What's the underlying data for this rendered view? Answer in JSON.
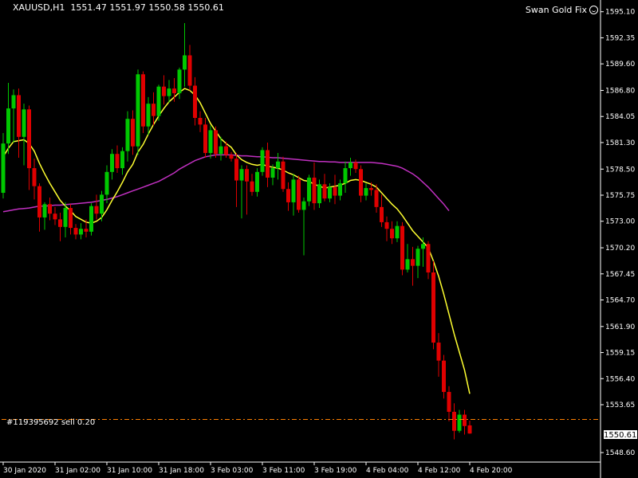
{
  "header": {
    "symbol": "XAUUSD,H1",
    "ohlc": "1551.47 1551.97 1550.58 1550.61"
  },
  "expert": {
    "name": "Swan Gold Fix",
    "icon": "smiley-icon"
  },
  "order": {
    "label": "#119395692 sell 0.20",
    "price": 1552.1
  },
  "current_price": "1550.61",
  "colors": {
    "background": "#000000",
    "bull": "#00c800",
    "bear": "#e00000",
    "ma_fast": "#ffff30",
    "ma_slow": "#c030c0",
    "order_line": "#ff8000",
    "axis": "#ffffff"
  },
  "chart_data": {
    "type": "candlestick",
    "y_ticks": [
      "1595.10",
      "1592.35",
      "1589.60",
      "1586.80",
      "1584.05",
      "1581.30",
      "1578.50",
      "1575.75",
      "1573.00",
      "1570.20",
      "1567.45",
      "1564.70",
      "1561.90",
      "1559.15",
      "1556.40",
      "1553.65",
      "1548.60"
    ],
    "ylim": [
      1547.6,
      1596.0
    ],
    "x_ticks": [
      "30 Jan 2020",
      "31 Jan 02:00",
      "31 Jan 10:00",
      "31 Jan 18:00",
      "3 Feb 03:00",
      "3 Feb 11:00",
      "3 Feb 19:00",
      "4 Feb 04:00",
      "4 Feb 12:00",
      "4 Feb 20:00"
    ],
    "x_tick_index": [
      0,
      10,
      20,
      30,
      40,
      50,
      60,
      70,
      80,
      90
    ],
    "candles": [
      {
        "o": 1576.0,
        "h": 1582.3,
        "l": 1575.4,
        "c": 1581.2
      },
      {
        "o": 1581.2,
        "h": 1587.6,
        "l": 1580.1,
        "c": 1584.9
      },
      {
        "o": 1584.9,
        "h": 1586.9,
        "l": 1581.3,
        "c": 1586.3
      },
      {
        "o": 1586.3,
        "h": 1587.0,
        "l": 1579.7,
        "c": 1581.9
      },
      {
        "o": 1581.9,
        "h": 1585.4,
        "l": 1578.9,
        "c": 1584.8
      },
      {
        "o": 1584.8,
        "h": 1585.2,
        "l": 1576.3,
        "c": 1578.6
      },
      {
        "o": 1578.6,
        "h": 1579.6,
        "l": 1575.3,
        "c": 1576.7
      },
      {
        "o": 1576.7,
        "h": 1577.0,
        "l": 1571.9,
        "c": 1573.4
      },
      {
        "o": 1573.4,
        "h": 1575.0,
        "l": 1572.1,
        "c": 1574.8
      },
      {
        "o": 1574.8,
        "h": 1575.5,
        "l": 1573.1,
        "c": 1573.8
      },
      {
        "o": 1573.8,
        "h": 1574.5,
        "l": 1572.6,
        "c": 1573.2
      },
      {
        "o": 1573.2,
        "h": 1573.9,
        "l": 1570.9,
        "c": 1572.4
      },
      {
        "o": 1572.4,
        "h": 1575.0,
        "l": 1571.3,
        "c": 1574.4
      },
      {
        "o": 1574.4,
        "h": 1574.8,
        "l": 1571.6,
        "c": 1572.3
      },
      {
        "o": 1572.3,
        "h": 1572.7,
        "l": 1571.1,
        "c": 1571.6
      },
      {
        "o": 1571.6,
        "h": 1572.8,
        "l": 1571.1,
        "c": 1572.2
      },
      {
        "o": 1572.2,
        "h": 1573.2,
        "l": 1571.3,
        "c": 1571.9
      },
      {
        "o": 1571.9,
        "h": 1574.9,
        "l": 1571.5,
        "c": 1574.6
      },
      {
        "o": 1574.6,
        "h": 1575.8,
        "l": 1573.2,
        "c": 1573.8
      },
      {
        "o": 1573.8,
        "h": 1576.2,
        "l": 1573.0,
        "c": 1575.8
      },
      {
        "o": 1575.8,
        "h": 1578.9,
        "l": 1574.9,
        "c": 1578.2
      },
      {
        "o": 1578.2,
        "h": 1580.6,
        "l": 1577.4,
        "c": 1580.1
      },
      {
        "o": 1580.1,
        "h": 1581.0,
        "l": 1578.1,
        "c": 1578.6
      },
      {
        "o": 1578.6,
        "h": 1580.8,
        "l": 1577.9,
        "c": 1580.4
      },
      {
        "o": 1580.4,
        "h": 1584.6,
        "l": 1579.3,
        "c": 1583.8
      },
      {
        "o": 1583.8,
        "h": 1584.7,
        "l": 1580.0,
        "c": 1580.9
      },
      {
        "o": 1580.9,
        "h": 1589.0,
        "l": 1580.0,
        "c": 1588.5
      },
      {
        "o": 1588.5,
        "h": 1588.8,
        "l": 1582.3,
        "c": 1583.0
      },
      {
        "o": 1583.0,
        "h": 1586.1,
        "l": 1582.1,
        "c": 1585.4
      },
      {
        "o": 1585.4,
        "h": 1586.6,
        "l": 1583.1,
        "c": 1584.1
      },
      {
        "o": 1584.1,
        "h": 1587.4,
        "l": 1583.6,
        "c": 1587.2
      },
      {
        "o": 1587.2,
        "h": 1588.4,
        "l": 1585.3,
        "c": 1586.2
      },
      {
        "o": 1586.2,
        "h": 1587.9,
        "l": 1585.5,
        "c": 1587.0
      },
      {
        "o": 1587.0,
        "h": 1588.1,
        "l": 1585.6,
        "c": 1586.5
      },
      {
        "o": 1586.5,
        "h": 1589.2,
        "l": 1585.9,
        "c": 1589.0
      },
      {
        "o": 1589.0,
        "h": 1593.9,
        "l": 1587.2,
        "c": 1590.5
      },
      {
        "o": 1590.5,
        "h": 1591.6,
        "l": 1586.8,
        "c": 1587.3
      },
      {
        "o": 1587.3,
        "h": 1588.2,
        "l": 1583.1,
        "c": 1583.9
      },
      {
        "o": 1583.9,
        "h": 1584.6,
        "l": 1582.4,
        "c": 1583.2
      },
      {
        "o": 1583.2,
        "h": 1583.9,
        "l": 1579.7,
        "c": 1580.2
      },
      {
        "o": 1580.2,
        "h": 1583.1,
        "l": 1579.6,
        "c": 1582.6
      },
      {
        "o": 1582.6,
        "h": 1583.0,
        "l": 1579.7,
        "c": 1580.1
      },
      {
        "o": 1580.1,
        "h": 1581.9,
        "l": 1579.4,
        "c": 1580.9
      },
      {
        "o": 1580.9,
        "h": 1581.4,
        "l": 1579.7,
        "c": 1580.0
      },
      {
        "o": 1580.0,
        "h": 1580.3,
        "l": 1579.3,
        "c": 1579.6
      },
      {
        "o": 1579.6,
        "h": 1580.2,
        "l": 1574.5,
        "c": 1577.3
      },
      {
        "o": 1577.3,
        "h": 1578.9,
        "l": 1573.3,
        "c": 1578.5
      },
      {
        "o": 1578.5,
        "h": 1578.9,
        "l": 1573.7,
        "c": 1577.2
      },
      {
        "o": 1577.2,
        "h": 1578.0,
        "l": 1575.7,
        "c": 1576.1
      },
      {
        "o": 1576.1,
        "h": 1578.6,
        "l": 1575.6,
        "c": 1578.2
      },
      {
        "o": 1578.2,
        "h": 1580.8,
        "l": 1577.8,
        "c": 1580.5
      },
      {
        "o": 1580.5,
        "h": 1581.3,
        "l": 1576.6,
        "c": 1577.6
      },
      {
        "o": 1577.6,
        "h": 1579.0,
        "l": 1576.8,
        "c": 1578.6
      },
      {
        "o": 1578.6,
        "h": 1580.2,
        "l": 1577.4,
        "c": 1579.3
      },
      {
        "o": 1579.3,
        "h": 1579.8,
        "l": 1576.1,
        "c": 1576.4
      },
      {
        "o": 1576.4,
        "h": 1577.1,
        "l": 1574.1,
        "c": 1575.0
      },
      {
        "o": 1575.0,
        "h": 1578.0,
        "l": 1573.6,
        "c": 1577.4
      },
      {
        "o": 1577.4,
        "h": 1577.8,
        "l": 1573.9,
        "c": 1574.2
      },
      {
        "o": 1574.2,
        "h": 1575.5,
        "l": 1569.4,
        "c": 1575.1
      },
      {
        "o": 1575.1,
        "h": 1577.9,
        "l": 1574.6,
        "c": 1577.6
      },
      {
        "o": 1577.6,
        "h": 1579.2,
        "l": 1574.2,
        "c": 1574.9
      },
      {
        "o": 1574.9,
        "h": 1577.4,
        "l": 1574.4,
        "c": 1576.9
      },
      {
        "o": 1576.9,
        "h": 1578.0,
        "l": 1575.1,
        "c": 1575.4
      },
      {
        "o": 1575.4,
        "h": 1577.0,
        "l": 1575.0,
        "c": 1576.6
      },
      {
        "o": 1576.6,
        "h": 1577.9,
        "l": 1574.8,
        "c": 1575.7
      },
      {
        "o": 1575.7,
        "h": 1577.4,
        "l": 1575.2,
        "c": 1577.0
      },
      {
        "o": 1577.0,
        "h": 1579.3,
        "l": 1576.0,
        "c": 1578.6
      },
      {
        "o": 1578.6,
        "h": 1579.7,
        "l": 1577.8,
        "c": 1579.2
      },
      {
        "o": 1579.2,
        "h": 1579.5,
        "l": 1578.1,
        "c": 1578.5
      },
      {
        "o": 1578.5,
        "h": 1578.9,
        "l": 1575.0,
        "c": 1575.7
      },
      {
        "o": 1575.7,
        "h": 1577.0,
        "l": 1575.2,
        "c": 1576.5
      },
      {
        "o": 1576.5,
        "h": 1577.1,
        "l": 1575.7,
        "c": 1576.3
      },
      {
        "o": 1576.3,
        "h": 1576.9,
        "l": 1573.9,
        "c": 1574.5
      },
      {
        "o": 1574.5,
        "h": 1575.8,
        "l": 1572.4,
        "c": 1572.9
      },
      {
        "o": 1572.9,
        "h": 1573.5,
        "l": 1570.9,
        "c": 1572.2
      },
      {
        "o": 1572.2,
        "h": 1573.0,
        "l": 1570.6,
        "c": 1571.2
      },
      {
        "o": 1571.2,
        "h": 1573.0,
        "l": 1570.8,
        "c": 1572.5
      },
      {
        "o": 1572.5,
        "h": 1572.9,
        "l": 1567.3,
        "c": 1567.9
      },
      {
        "o": 1567.9,
        "h": 1570.6,
        "l": 1567.6,
        "c": 1569.0
      },
      {
        "o": 1569.0,
        "h": 1570.3,
        "l": 1566.2,
        "c": 1568.3
      },
      {
        "o": 1568.3,
        "h": 1570.4,
        "l": 1567.0,
        "c": 1570.1
      },
      {
        "o": 1570.1,
        "h": 1571.3,
        "l": 1568.2,
        "c": 1570.6
      },
      {
        "o": 1570.6,
        "h": 1570.9,
        "l": 1566.9,
        "c": 1567.6
      },
      {
        "o": 1567.6,
        "h": 1568.8,
        "l": 1559.5,
        "c": 1560.2
      },
      {
        "o": 1560.2,
        "h": 1561.2,
        "l": 1556.6,
        "c": 1558.3
      },
      {
        "o": 1558.3,
        "h": 1558.9,
        "l": 1554.3,
        "c": 1555.0
      },
      {
        "o": 1555.0,
        "h": 1555.6,
        "l": 1551.9,
        "c": 1552.9
      },
      {
        "o": 1552.9,
        "h": 1553.8,
        "l": 1550.0,
        "c": 1550.9
      },
      {
        "o": 1550.9,
        "h": 1553.1,
        "l": 1550.7,
        "c": 1552.6
      },
      {
        "o": 1552.6,
        "h": 1553.1,
        "l": 1550.5,
        "c": 1551.4
      },
      {
        "o": 1551.47,
        "h": 1551.97,
        "l": 1550.58,
        "c": 1550.61
      }
    ],
    "ma_fast": [
      1579.8,
      1580.7,
      1581.4,
      1581.5,
      1581.6,
      1581.2,
      1580.4,
      1579.1,
      1578.0,
      1577.0,
      1576.1,
      1575.2,
      1574.6,
      1574.1,
      1573.5,
      1573.2,
      1572.9,
      1572.8,
      1573.0,
      1573.4,
      1574.2,
      1575.2,
      1576.1,
      1577.1,
      1578.2,
      1579.0,
      1580.3,
      1581.1,
      1582.2,
      1583.2,
      1584.1,
      1584.9,
      1585.6,
      1586.1,
      1586.6,
      1587.0,
      1586.8,
      1586.3,
      1585.5,
      1584.4,
      1583.3,
      1582.5,
      1581.7,
      1581.2,
      1580.8,
      1580.0,
      1579.5,
      1579.2,
      1579.0,
      1578.9,
      1579.0,
      1578.8,
      1578.7,
      1578.6,
      1578.4,
      1578.1,
      1577.9,
      1577.6,
      1577.3,
      1577.2,
      1576.9,
      1576.7,
      1576.5,
      1576.6,
      1576.7,
      1576.8,
      1577.0,
      1577.3,
      1577.4,
      1577.3,
      1577.1,
      1576.9,
      1576.6,
      1576.0,
      1575.4,
      1574.8,
      1574.3,
      1573.6,
      1572.8,
      1572.0,
      1571.4,
      1570.8,
      1570.2,
      1568.8,
      1567.2,
      1565.3,
      1563.2,
      1561.1,
      1559.2,
      1557.3,
      1554.8
    ],
    "ma_slow": [
      1574.0,
      1574.1,
      1574.2,
      1574.3,
      1574.35,
      1574.4,
      1574.5,
      1574.6,
      1574.6,
      1574.65,
      1574.7,
      1574.7,
      1574.75,
      1574.8,
      1574.85,
      1574.9,
      1574.95,
      1575.0,
      1575.1,
      1575.2,
      1575.3,
      1575.45,
      1575.6,
      1575.8,
      1576.0,
      1576.2,
      1576.4,
      1576.6,
      1576.8,
      1577.0,
      1577.2,
      1577.5,
      1577.8,
      1578.1,
      1578.5,
      1578.8,
      1579.1,
      1579.4,
      1579.6,
      1579.8,
      1579.9,
      1580.0,
      1580.0,
      1580.0,
      1580.0,
      1579.95,
      1579.9,
      1579.9,
      1579.85,
      1579.8,
      1579.8,
      1579.75,
      1579.7,
      1579.7,
      1579.65,
      1579.6,
      1579.55,
      1579.5,
      1579.45,
      1579.4,
      1579.35,
      1579.3,
      1579.3,
      1579.25,
      1579.25,
      1579.2,
      1579.2,
      1579.2,
      1579.2,
      1579.2,
      1579.2,
      1579.2,
      1579.15,
      1579.1,
      1579.0,
      1578.9,
      1578.8,
      1578.6,
      1578.3,
      1578.0,
      1577.6,
      1577.1,
      1576.6,
      1576.0,
      1575.4,
      1574.8,
      1574.1
    ]
  }
}
